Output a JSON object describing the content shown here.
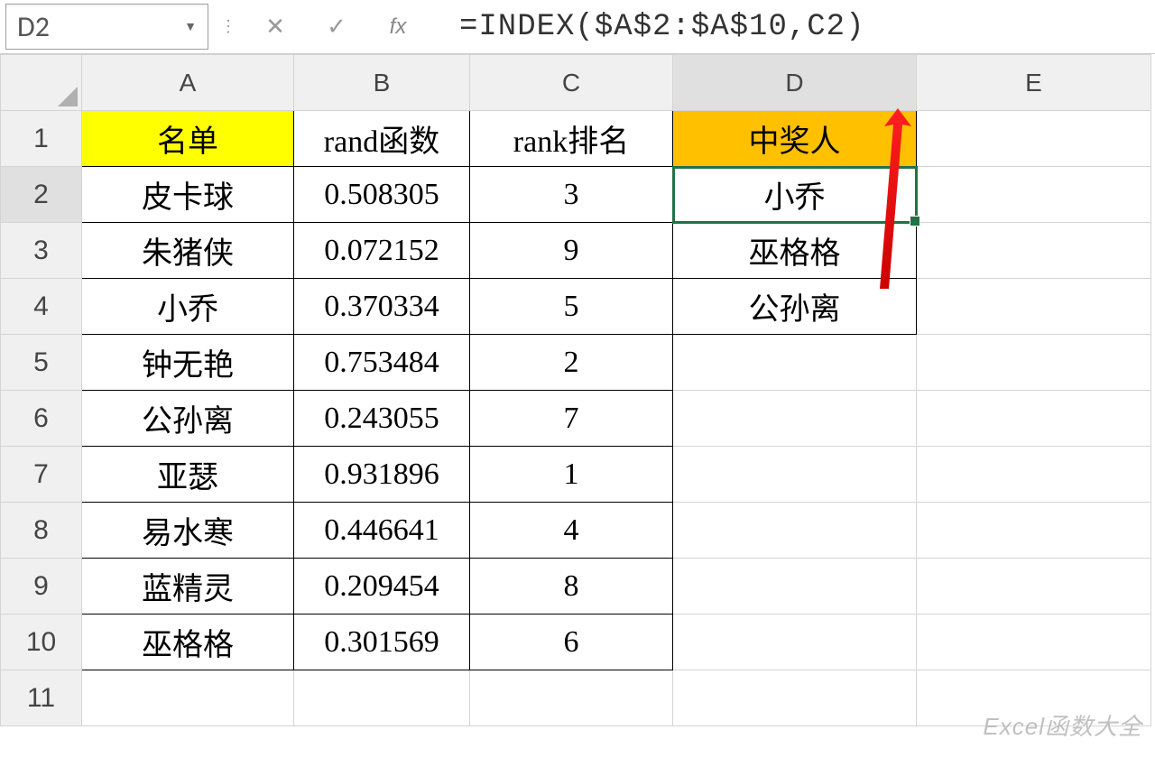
{
  "name_box": "D2",
  "formula_bar": {
    "cancel": "✕",
    "enter": "✓",
    "fx": "fx",
    "formula": "=INDEX($A$2:$A$10,C2)"
  },
  "columns": [
    "A",
    "B",
    "C",
    "D",
    "E"
  ],
  "row_numbers": [
    "1",
    "2",
    "3",
    "4",
    "5",
    "6",
    "7",
    "8",
    "9",
    "10",
    "11"
  ],
  "headers": {
    "A": "名单",
    "B": "rand函数",
    "C": "rank排名",
    "D": "中奖人"
  },
  "rows": [
    {
      "A": "皮卡球",
      "B": "0.508305",
      "C": "3",
      "D": "小乔"
    },
    {
      "A": "朱猪侠",
      "B": "0.072152",
      "C": "9",
      "D": "巫格格"
    },
    {
      "A": "小乔",
      "B": "0.370334",
      "C": "5",
      "D": "公孙离"
    },
    {
      "A": "钟无艳",
      "B": "0.753484",
      "C": "2",
      "D": ""
    },
    {
      "A": "公孙离",
      "B": "0.243055",
      "C": "7",
      "D": ""
    },
    {
      "A": "亚瑟",
      "B": "0.931896",
      "C": "1",
      "D": ""
    },
    {
      "A": "易水寒",
      "B": "0.446641",
      "C": "4",
      "D": ""
    },
    {
      "A": "蓝精灵",
      "B": "0.209454",
      "C": "8",
      "D": ""
    },
    {
      "A": "巫格格",
      "B": "0.301569",
      "C": "6",
      "D": ""
    }
  ],
  "active_cell": "D2",
  "watermark": "Excel函数大全"
}
